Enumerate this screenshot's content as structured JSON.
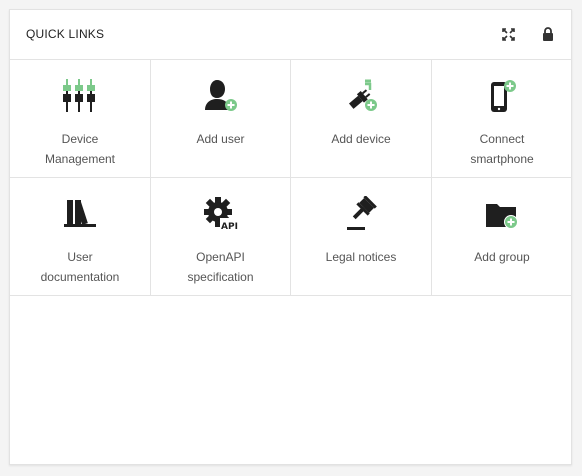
{
  "panel": {
    "title": "QUICK LINKS",
    "actions": {
      "expand_icon": "expand-icon",
      "lock_icon": "lock-icon"
    }
  },
  "tiles": [
    {
      "label": "Device\nManagement",
      "icon": "device-management-icon"
    },
    {
      "label": "Add user",
      "icon": "add-user-icon"
    },
    {
      "label": "Add device",
      "icon": "add-device-icon"
    },
    {
      "label": "Connect\nsmartphone",
      "icon": "connect-smartphone-icon"
    },
    {
      "label": "User\ndocumentation",
      "icon": "user-documentation-icon"
    },
    {
      "label": "OpenAPI\nspecification",
      "icon": "openapi-icon"
    },
    {
      "label": "Legal notices",
      "icon": "legal-notices-icon"
    },
    {
      "label": "Add group",
      "icon": "add-group-icon"
    }
  ],
  "colors": {
    "icon_dark": "#1f1f1f",
    "accent_green": "#7cc98a",
    "text": "#555555"
  }
}
